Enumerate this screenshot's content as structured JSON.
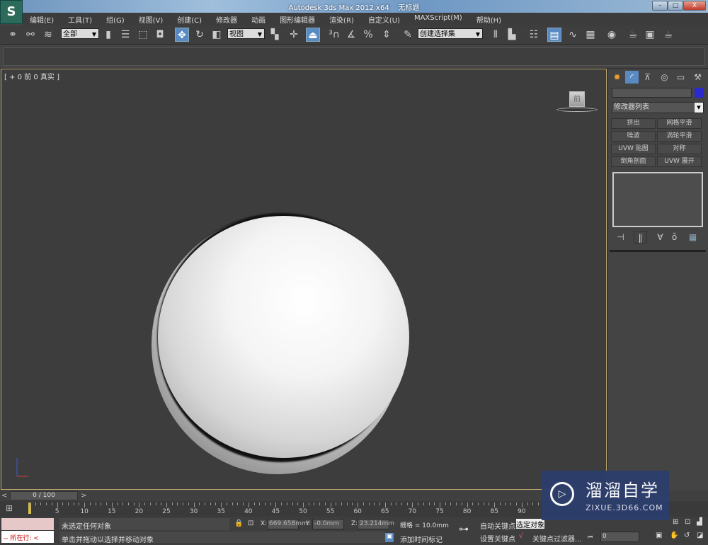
{
  "window": {
    "title": "Autodesk 3ds Max  2012 x64",
    "doc": "无标题",
    "min": "–",
    "max": "□",
    "close": "X"
  },
  "menu": [
    "编辑(E)",
    "工具(T)",
    "组(G)",
    "视图(V)",
    "创建(C)",
    "修改器",
    "动画",
    "图形编辑器",
    "渲染(R)",
    "自定义(U)",
    "MAXScript(M)",
    "帮助(H)"
  ],
  "toolbar": {
    "selection_filter": "全部",
    "ref_coord": "视图",
    "named_selection": "创建选择集"
  },
  "viewport": {
    "label": "[ + 0 前 0 真实 ]",
    "viewcube_face": "前"
  },
  "command_panel": {
    "modifier_list": "修改器列表",
    "object_color": "#2a2ad0",
    "modifier_buttons": [
      "挤出",
      "网格平滑",
      "噪波",
      "涡轮平滑",
      "UVW 贴图",
      "对称",
      "倒角剖面",
      "UVW 展开"
    ]
  },
  "timeline": {
    "frame": "0 / 100",
    "prev": "<",
    "next": ">",
    "ticks": [
      5,
      10,
      15,
      20,
      25,
      30,
      35,
      40,
      45,
      50,
      55,
      60,
      65,
      70,
      75,
      80,
      85,
      90
    ]
  },
  "status": {
    "script_label": "-- 所在行: <",
    "selection": "未选定任何对象",
    "prompt": "单击并拖动以选择并移动对象",
    "x_label": "X:",
    "x": "669.658mm",
    "y_label": "Y:",
    "y": "-0.0mm",
    "z_label": "Z:",
    "z": "23.214mm",
    "grid": "栅格 = 10.0mm",
    "add_time_tag": "添加时间标记",
    "auto_key": "自动关键点",
    "set_key": "设置关键点",
    "selected": "选定对象",
    "key_filters": "关键点过滤器...",
    "frame_value": "0"
  },
  "watermark": {
    "name": "溜溜自学",
    "url": "ZIXUE.3D66.COM"
  }
}
